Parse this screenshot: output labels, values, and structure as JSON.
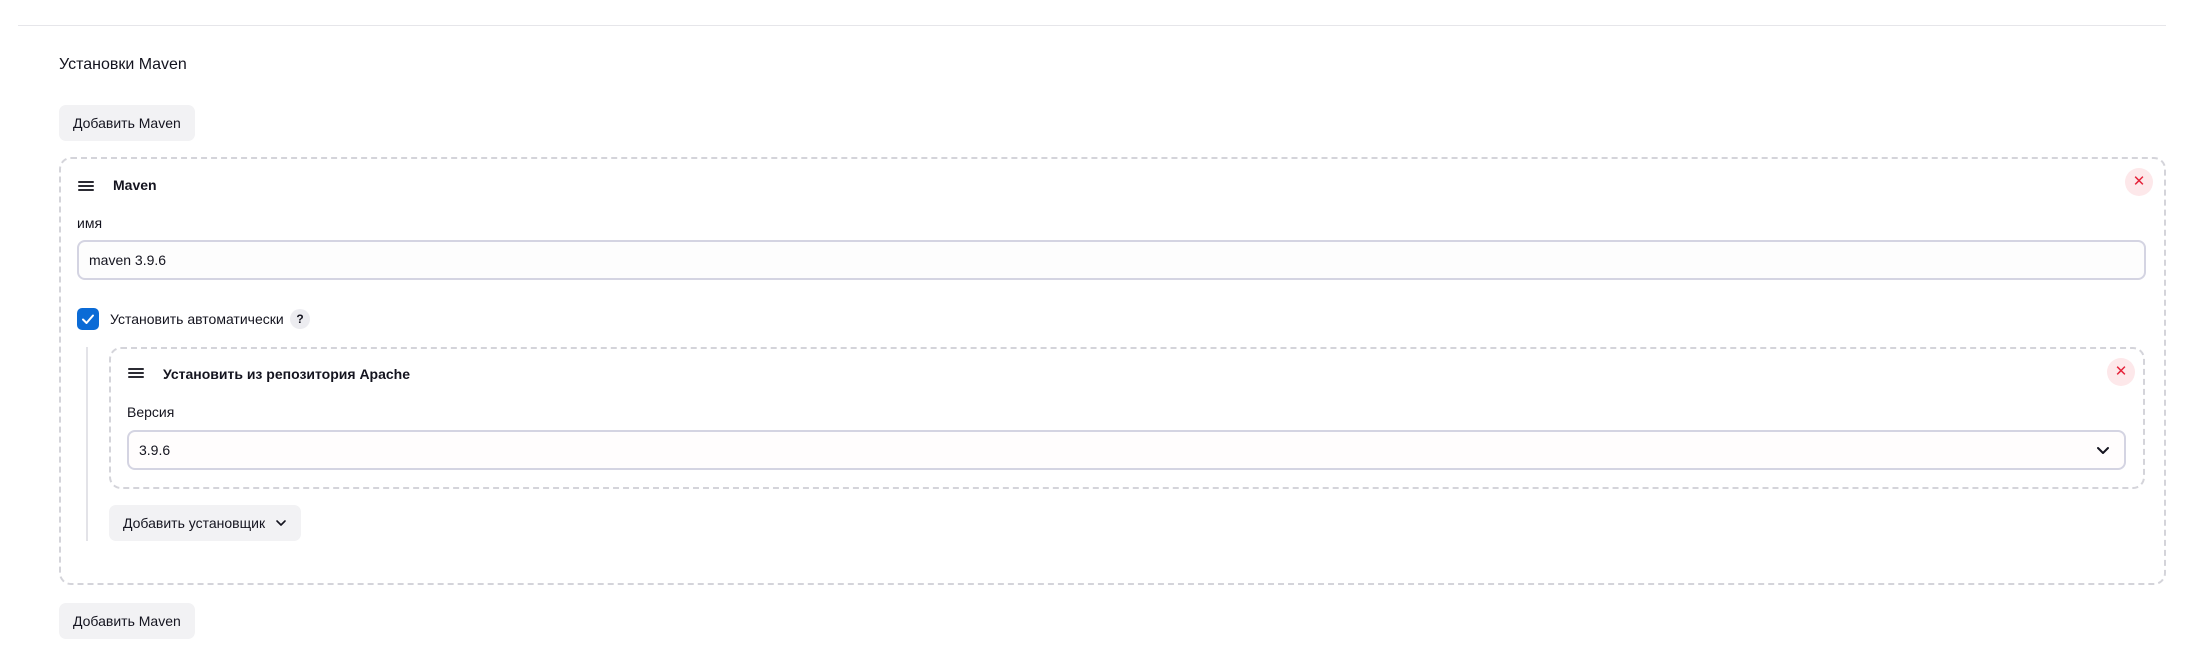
{
  "section": {
    "title": "Установки Maven",
    "add_button_top": "Добавить Maven",
    "add_button_bottom": "Добавить Maven"
  },
  "maven_item": {
    "title": "Maven",
    "delete_icon": "close-icon",
    "name_label": "имя",
    "name_value": "maven 3.9.6",
    "auto_install": {
      "checked": true,
      "label": "Установить автоматически",
      "help": "?"
    },
    "installer": {
      "title": "Установить из репозитория Apache",
      "version_label": "Версия",
      "version_value": "3.9.6"
    },
    "add_installer_label": "Добавить установщик"
  },
  "colors": {
    "accent": "#0b6bd6",
    "danger": "#e5243b",
    "danger_bg": "#fde8ea",
    "button_bg": "#f2f2f4",
    "dashed_border": "#d4d4da"
  }
}
